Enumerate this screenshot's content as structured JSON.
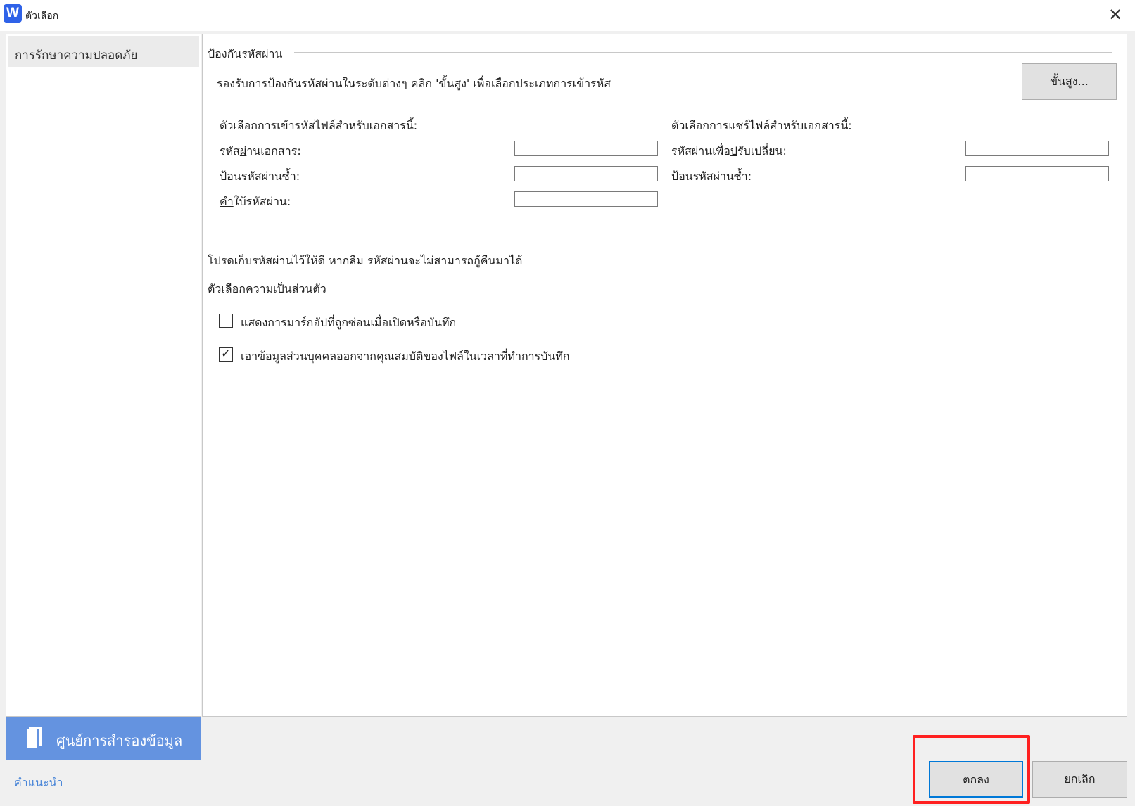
{
  "window": {
    "icon_letter": "W",
    "title": "ตัวเลือก",
    "close": "✕"
  },
  "sidebar": {
    "items": [
      {
        "label": "การรักษาความปลอดภัย",
        "selected": true
      }
    ],
    "backup_label": "ศูนย์การสำรองข้อมูล",
    "help_link": "คำแนะนำ"
  },
  "password": {
    "group_title": "ป้องกันรหัสผ่าน",
    "description": "รองรับการป้องกันรหัสผ่านในระดับต่างๆ คลิก 'ขั้นสูง' เพื่อเลือกประเภทการเข้ารหัส",
    "advanced_button": {
      "pre": "ข",
      "key": "ั้",
      "post": "นสูง..."
    },
    "encrypt_header": "ตัวเลือกการเข้ารหัสไฟล์สำหรับเอกสารนี้:",
    "share_header": "ตัวเลือกการแชร์ไฟล์สำหรับเอกสารนี้:",
    "doc_password": {
      "pre": "รหัส",
      "key": "ผ่",
      "post": "านเอกสาร:",
      "value": ""
    },
    "doc_reenter": {
      "pre": "ป้อน",
      "key": "ร",
      "post": "หัสผ่านซ้ำ:",
      "value": ""
    },
    "hint": {
      "pre": "",
      "key": "ค",
      "post": "ำใบ้รหัสผ่าน:",
      "value": ""
    },
    "modify_password": {
      "pre": "รหัสผ่านเพื่อ",
      "key": "ป",
      "post": "รับเปลี่ยน:",
      "value": ""
    },
    "modify_reenter": {
      "pre": "",
      "key": "ป้",
      "post": "อนรหัสผ่านซ้ำ:",
      "value": ""
    },
    "note": "โปรดเก็บรหัสผ่านไว้ให้ดี หากลืม รหัสผ่านจะไม่สามารถกู้คืนมาได้"
  },
  "privacy": {
    "group_title": "ตัวเลือกความเป็นส่วนตัว",
    "options": [
      {
        "label": "แสดงการมาร์กอัปที่ถูกซ่อนเมื่อเปิดหรือบันทึก",
        "checked": false,
        "mark": ""
      },
      {
        "label": "เอาข้อมูลส่วนบุคคลออกจากคุณสมบัติของไฟล์ในเวลาที่ทำการบันทึก",
        "checked": true,
        "mark": "✓"
      }
    ]
  },
  "footer": {
    "ok": "ตกลง",
    "cancel": "ยกเลิก"
  },
  "colors": {
    "accent": "#6493e0",
    "highlight": "#ff2020"
  }
}
